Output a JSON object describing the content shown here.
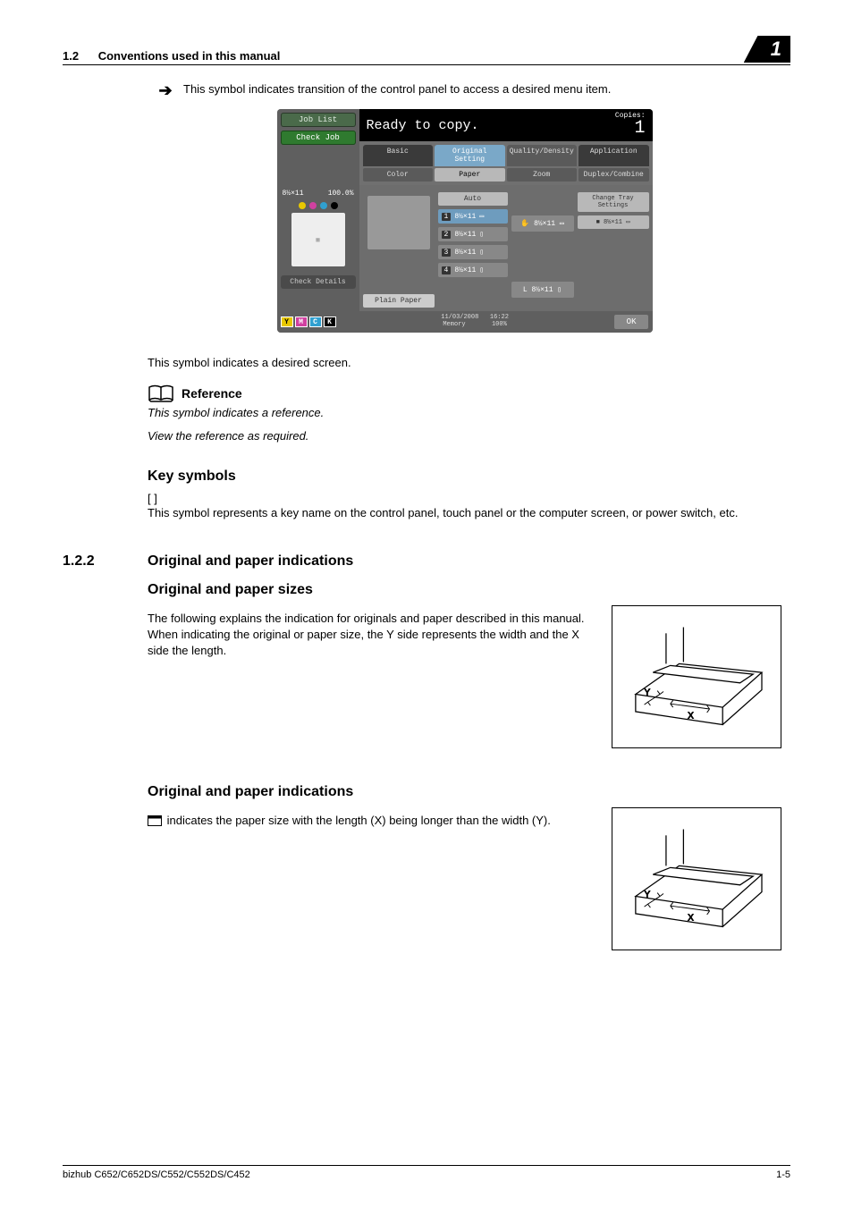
{
  "header": {
    "section_number": "1.2",
    "section_title": "Conventions used in this manual",
    "chapter_badge": "1"
  },
  "arrow_line": "This symbol indicates transition of the control panel to access a desired menu item.",
  "panel": {
    "job_list": "Job List",
    "check_job": "Check Job",
    "status": "Ready to copy.",
    "copies_label": "Copies:",
    "copies_value": "1",
    "tabs": [
      "Basic",
      "Original Setting",
      "Quality/Density",
      "Application"
    ],
    "subtabs": [
      "Color",
      "Paper",
      "Zoom",
      "Duplex/Combine"
    ],
    "side_tray_label": "8½×11",
    "side_tray_pct": "100.0%",
    "check_details": "Check Details",
    "plain_paper": "Plain Paper",
    "auto": "Auto",
    "trays": [
      {
        "num": "1",
        "label": "8½×11"
      },
      {
        "num": "2",
        "label": "8½×11"
      },
      {
        "num": "3",
        "label": "8½×11"
      },
      {
        "num": "4",
        "label": "8½×11"
      }
    ],
    "right_trays": [
      "8½×11",
      "8½×11"
    ],
    "change_tray": "Change Tray Settings",
    "change_tray_sub": "8½×11",
    "footer_date": "11/03/2008",
    "footer_time": "16:22",
    "footer_mem": "Memory",
    "footer_mem_pct": "100%",
    "ok": "OK",
    "ymck": [
      "Y",
      "M",
      "C",
      "K"
    ]
  },
  "desired_screen": "This symbol indicates a desired screen.",
  "reference": {
    "title": "Reference",
    "line1": "This symbol indicates a reference.",
    "line2": "View the reference as required."
  },
  "key_symbols": {
    "heading": "Key symbols",
    "bracket": "[ ]",
    "desc": "This symbol represents a key name on the control panel, touch panel or the computer screen, or power switch, etc."
  },
  "sec_122": {
    "num": "1.2.2",
    "title": "Original and paper indications"
  },
  "sizes": {
    "heading": "Original and paper sizes",
    "p1": "The following explains the indication for originals and paper described in this manual.",
    "p2": "When indicating the original or paper size, the Y side represents the width and the X side the length."
  },
  "indications": {
    "heading": "Original and paper indications",
    "p1_a": "indicates the paper size with the length (X) being longer than the width (Y)."
  },
  "footer": {
    "left": "bizhub C652/C652DS/C552/C552DS/C452",
    "right": "1-5"
  }
}
